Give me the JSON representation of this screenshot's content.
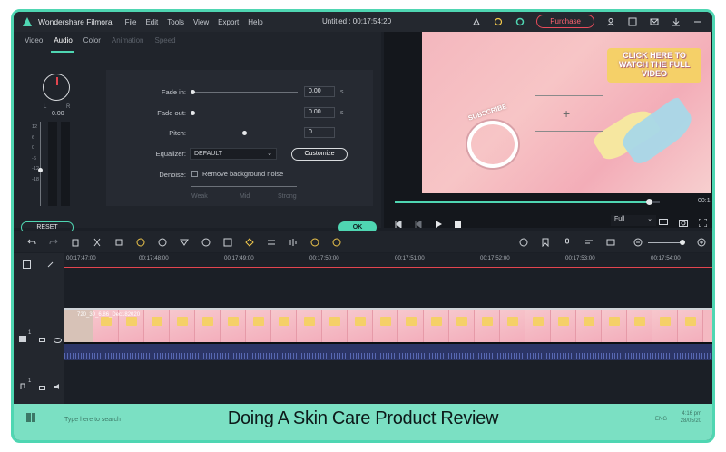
{
  "app": {
    "name": "Wondershare Filmora",
    "title": "Untitled : 00:17:54:20",
    "menu": [
      "File",
      "Edit",
      "Tools",
      "View",
      "Export",
      "Help"
    ],
    "purchase_label": "Purchase",
    "accent": "#4fd6b2"
  },
  "panel": {
    "tabs": [
      "Video",
      "Audio",
      "Color",
      "Animation",
      "Speed"
    ],
    "active_tab": "Audio",
    "volume": {
      "value": "0.00",
      "left": "L",
      "right": "R"
    },
    "meter_scale": [
      "12",
      "6",
      "0",
      "-6",
      "-12",
      "-18"
    ],
    "fade_in": {
      "label": "Fade in:",
      "value": "0.00",
      "unit": "s"
    },
    "fade_out": {
      "label": "Fade out:",
      "value": "0.00",
      "unit": "s"
    },
    "pitch": {
      "label": "Pitch:",
      "value": "0"
    },
    "equalizer": {
      "label": "Equalizer:",
      "value": "DEFAULT",
      "button": "Customize"
    },
    "denoise": {
      "label": "Denoise:",
      "option": "Remove background noise",
      "levels": [
        "Weak",
        "Mid",
        "Strong"
      ]
    },
    "reset_label": "RESET",
    "ok_label": "OK"
  },
  "preview": {
    "cta_text": "CLICK HERE TO WATCH THE FULL VIDEO",
    "subscribe_text": "SUBSCRIBE",
    "time": "00:1",
    "quality": "Full"
  },
  "timeline": {
    "ticks": [
      "00:17:47:00",
      "00:17:48:00",
      "00:17:49:00",
      "00:17:50:00",
      "00:17:51:00",
      "00:17:52:00",
      "00:17:53:00",
      "00:17:54:00"
    ],
    "clip_label": "720_30_6.86_Dec182020",
    "video_track": "1",
    "audio_track": "1"
  },
  "caption": {
    "text": "Doing A Skin Care Product Review",
    "taskbar_search": "Type here to search",
    "tray_lang": "ENG",
    "tray_time": "4:16 pm",
    "tray_date": "28/05/20"
  }
}
